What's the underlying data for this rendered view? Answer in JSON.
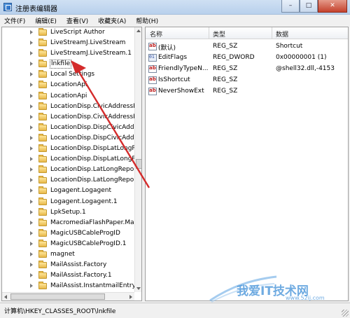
{
  "window": {
    "title": "注册表编辑器",
    "min_glyph": "–",
    "max_glyph": "□",
    "close_glyph": "✕"
  },
  "menu": [
    "文件(F)",
    "编辑(E)",
    "查看(V)",
    "收藏夹(A)",
    "帮助(H)"
  ],
  "tree": {
    "items": [
      "LiveScript Author",
      "LiveStreamJ.LiveStream",
      "LiveStreamJ.LiveStream.1",
      "lnkfile",
      "Local Settings",
      "LocationApi",
      "LocationApi",
      "LocationDisp.CivicAddressRe",
      "LocationDisp.CivicAddressRe",
      "LocationDisp.DispCivicAddre",
      "LocationDisp.DispCivicAddre",
      "LocationDisp.DispLatLongRe",
      "LocationDisp.DispLatLongRe",
      "LocationDisp.LatLongReport",
      "LocationDisp.LatLongReport",
      "Logagent.Logagent",
      "Logagent.Logagent.1",
      "LpkSetup.1",
      "MacromediaFlashPaper.Mac",
      "MagicUSBCableProgID",
      "MagicUSBCableProgID.1",
      "magnet",
      "MailAssist.Factory",
      "MailAssist.Factory.1",
      "MailAssist.InstantmailEntry"
    ],
    "selected_index": 3
  },
  "list": {
    "headers": {
      "name": "名称",
      "type": "类型",
      "data": "数据"
    },
    "rows": [
      {
        "name": "(默认)",
        "type": "REG_SZ",
        "data": "Shortcut",
        "icon": "string-value-icon"
      },
      {
        "name": "EditFlags",
        "type": "REG_DWORD",
        "data": "0x00000001 (1)",
        "icon": "binary-value-icon"
      },
      {
        "name": "FriendlyTypeN...",
        "type": "REG_SZ",
        "data": "@shell32.dll,-4153",
        "icon": "string-value-icon"
      },
      {
        "name": "IsShortcut",
        "type": "REG_SZ",
        "data": "",
        "icon": "string-value-icon"
      },
      {
        "name": "NeverShowExt",
        "type": "REG_SZ",
        "data": "",
        "icon": "string-value-icon"
      }
    ]
  },
  "status": {
    "path": "计算机\\HKEY_CLASSES_ROOT\\lnkfile"
  },
  "watermark": {
    "main": "我爱IT技术网",
    "url": "www.52ij.com"
  },
  "colors": {
    "list_bg": "#ffffff",
    "tree_bg": "#ffffff",
    "arrow": "#d42b2b",
    "watermark": "#3f8fd8"
  }
}
